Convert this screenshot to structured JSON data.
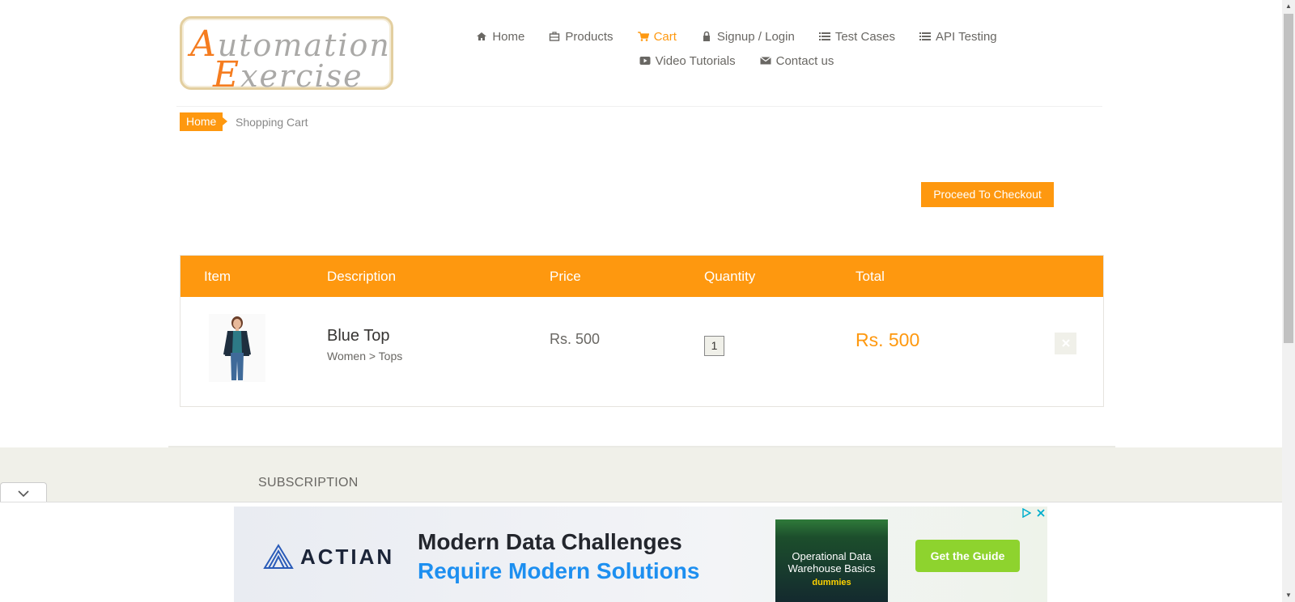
{
  "logo": {
    "line1_cap": "A",
    "line1_rest": "utomation",
    "line2_cap": "E",
    "line2_rest": "xercise"
  },
  "nav": {
    "items": [
      {
        "label": "Home",
        "icon": "home-icon"
      },
      {
        "label": "Products",
        "icon": "products-icon"
      },
      {
        "label": "Cart",
        "icon": "cart-icon",
        "active": true
      },
      {
        "label": "Signup / Login",
        "icon": "lock-icon"
      },
      {
        "label": "Test Cases",
        "icon": "list-icon"
      },
      {
        "label": "API Testing",
        "icon": "list-icon"
      },
      {
        "label": "Video Tutorials",
        "icon": "youtube-icon"
      },
      {
        "label": "Contact us",
        "icon": "envelope-icon"
      }
    ]
  },
  "breadcrumb": {
    "home": "Home",
    "current": "Shopping Cart"
  },
  "checkout": {
    "label": "Proceed To Checkout"
  },
  "cart": {
    "headers": {
      "item": "Item",
      "description": "Description",
      "price": "Price",
      "quantity": "Quantity",
      "total": "Total"
    },
    "rows": [
      {
        "name": "Blue Top",
        "category": "Women > Tops",
        "price": "Rs. 500",
        "quantity": "1",
        "total": "Rs. 500",
        "delete_icon": "close-icon"
      }
    ]
  },
  "footer": {
    "subscription": "SUBSCRIPTION"
  },
  "ad": {
    "brand": "ACTIAN",
    "headline1": "Modern Data Challenges",
    "headline2": "Require Modern Solutions",
    "book_title_line1": "Operational Data",
    "book_title_line2": "Warehouse Basics",
    "book_brand": "dummies",
    "cta": "Get the Guide",
    "controls": [
      "adchoices-icon",
      "close-icon"
    ]
  },
  "colors": {
    "accent": "#fe980f",
    "text": "#696763",
    "footer_bg": "#f0f0e9"
  }
}
